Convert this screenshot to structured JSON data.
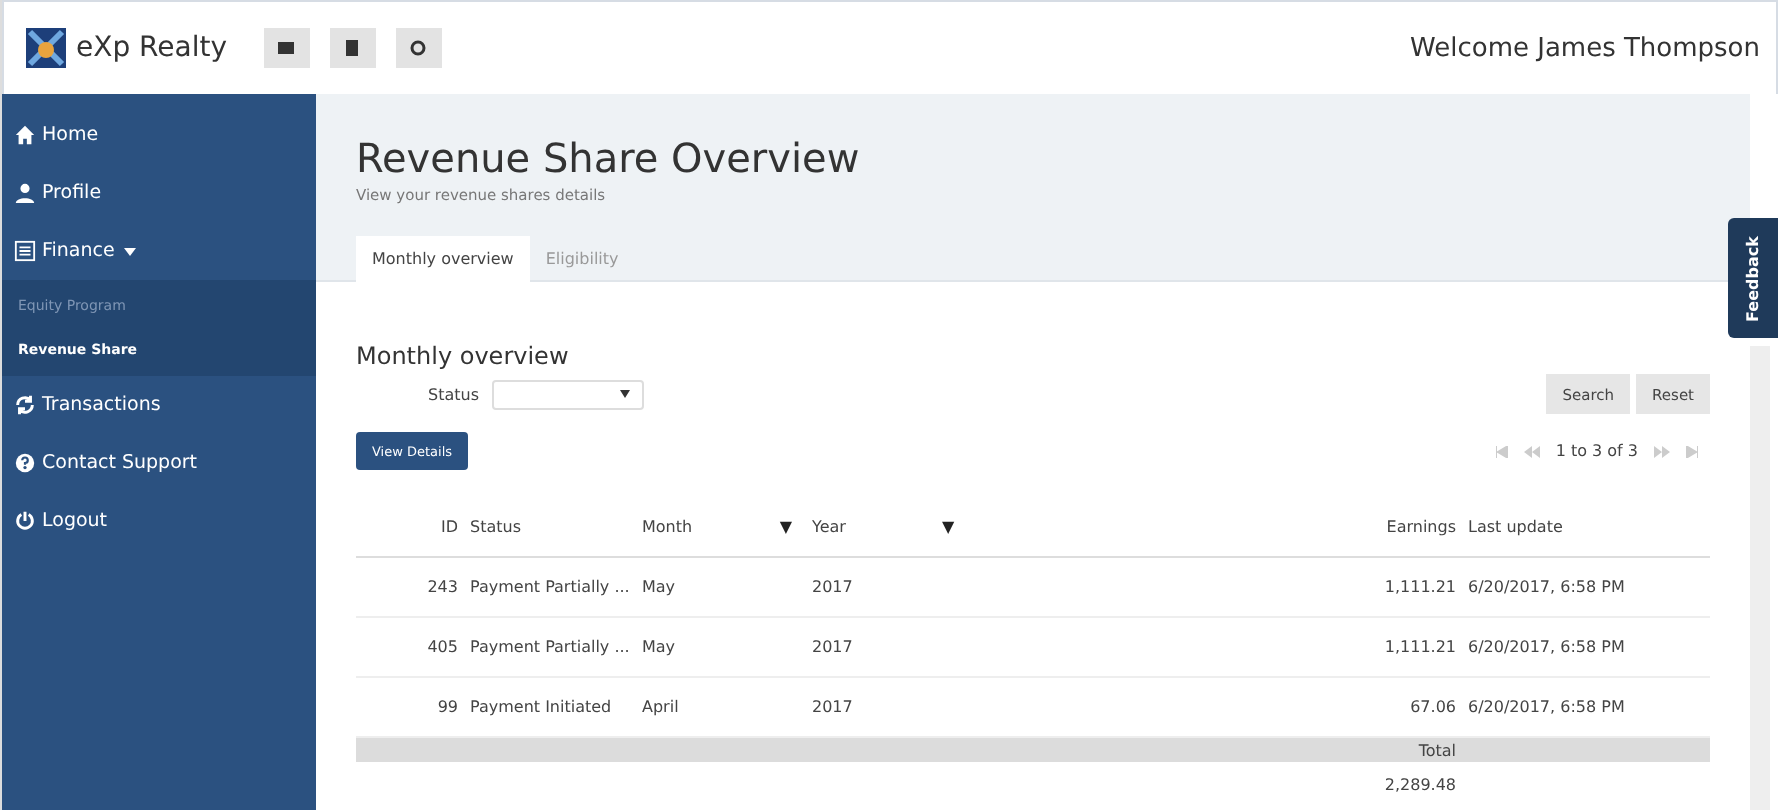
{
  "header": {
    "brand": "eXp Realty",
    "welcome": "Welcome James Thompson"
  },
  "sidebar": {
    "items": [
      {
        "label": "Home"
      },
      {
        "label": "Profile"
      },
      {
        "label": "Finance",
        "expanded": true,
        "children": [
          {
            "label": "Equity Program",
            "selected": false
          },
          {
            "label": "Revenue Share",
            "selected": true
          }
        ]
      },
      {
        "label": "Transactions"
      },
      {
        "label": "Contact Support"
      },
      {
        "label": "Logout"
      }
    ]
  },
  "page": {
    "title": "Revenue Share Overview",
    "subtitle": "View your revenue shares details"
  },
  "tabs": [
    {
      "label": "Monthly overview",
      "selected": true
    },
    {
      "label": "Eligibility",
      "selected": false
    }
  ],
  "section_title": "Monthly overview",
  "filter": {
    "label": "Status"
  },
  "buttons": {
    "search": "Search",
    "reset": "Reset",
    "view_details": "View Details"
  },
  "pager": {
    "text": "1 to 3 of 3"
  },
  "table": {
    "columns": [
      {
        "label": "ID",
        "filter": false
      },
      {
        "label": "Status",
        "filter": false
      },
      {
        "label": "Month",
        "filter": true
      },
      {
        "label": "Year",
        "filter": true
      },
      {
        "label": "Earnings",
        "filter": false
      },
      {
        "label": "Last update",
        "filter": false
      }
    ],
    "filter_mark": "▼",
    "rows": [
      [
        "243",
        "Payment Partially ...",
        "May",
        "2017",
        "1,111.21",
        "6/20/2017, 6:58 PM"
      ],
      [
        "405",
        "Payment Partially ...",
        "May",
        "2017",
        "1,111.21",
        "6/20/2017, 6:58 PM"
      ],
      [
        "99",
        "Payment Initiated",
        "April",
        "2017",
        "67.06",
        "6/20/2017, 6:58 PM"
      ]
    ],
    "total_label": "Total",
    "total_value": "2,289.48"
  },
  "feedback": "Feedback"
}
